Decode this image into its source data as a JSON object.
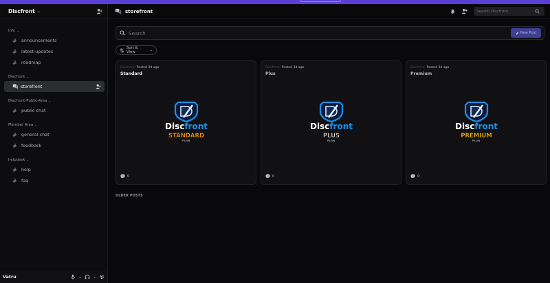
{
  "server": {
    "name": "Discfront"
  },
  "sidebar": {
    "categories": [
      {
        "label": "Info",
        "channels": [
          "announcements",
          "latest-updates",
          "roadmap"
        ]
      },
      {
        "label": "Discfront",
        "channels": [
          "storefront"
        ]
      },
      {
        "label": "Discfront-Public-Area",
        "channels": [
          "public-chat"
        ]
      },
      {
        "label": "Member Area",
        "channels": [
          "general-chat",
          "feedback"
        ]
      },
      {
        "label": "helpdesk",
        "channels": [
          "help",
          "faq"
        ]
      }
    ],
    "active_channel": "storefront"
  },
  "user": {
    "name": "Vatru"
  },
  "header": {
    "title": "storefront",
    "search_placeholder": "Search Discfront"
  },
  "forum": {
    "search_placeholder": "Search",
    "new_post_label": "New Post",
    "sort_label": "Sort & View",
    "older_posts_label": "OLDER POSTS"
  },
  "posts": [
    {
      "author": "Discfront",
      "posted": "Posted 3d ago",
      "title": "Standard",
      "comments": "0",
      "logo_brand": "Discfront",
      "logo_plan": "STANDARD",
      "logo_sub": "PLAN",
      "plan_color": "#f0a020"
    },
    {
      "author": "Discfront",
      "posted": "Posted 3d ago",
      "title": "Plus",
      "comments": "0",
      "logo_brand": "Discfront",
      "logo_plan": "PLUS",
      "logo_sub": "PLAN",
      "plan_color": "#cfd3da"
    },
    {
      "author": "Discfront",
      "posted": "Posted 3d ago",
      "title": "Premium",
      "comments": "0",
      "logo_brand": "Discfront",
      "logo_plan": "PREMIUM",
      "logo_sub": "PLAN",
      "plan_color": "#f5c518"
    }
  ],
  "colors": {
    "accent": "#5b3fd8",
    "brand_blue": "#1d8fe8",
    "active_bg": "#2b2d31"
  }
}
